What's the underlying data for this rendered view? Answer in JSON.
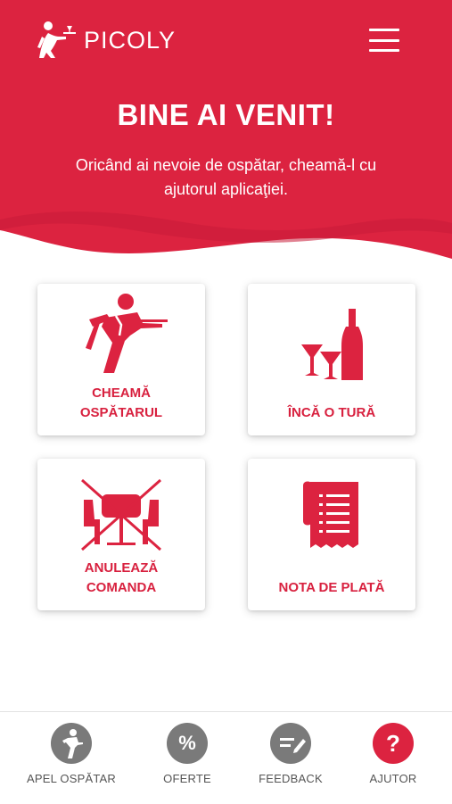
{
  "app": {
    "name": "PICOLY"
  },
  "colors": {
    "brand": "#dc2340",
    "icon_grey": "#7a7a7a",
    "text_grey": "#555555"
  },
  "header": {
    "title": "BINE AI VENIT!",
    "subtitle": "Oricând ai nevoie de ospătar, cheamă-l cu ajutorul aplicaţiei."
  },
  "actions": [
    {
      "label": "CHEAMĂ\nOSPĂTARUL",
      "icon": "waiter-icon"
    },
    {
      "label": "ÎNCĂ O TURĂ",
      "icon": "drinks-icon"
    },
    {
      "label": "ANULEAZĂ\nCOMANDA",
      "icon": "cancel-table-icon"
    },
    {
      "label": "NOTA DE PLATĂ",
      "icon": "receipt-icon"
    }
  ],
  "bottom_nav": [
    {
      "label": "APEL OSPĂTAR",
      "icon": "waiter-call-icon"
    },
    {
      "label": "OFERTE",
      "icon": "percent-icon"
    },
    {
      "label": "FEEDBACK",
      "icon": "feedback-icon"
    },
    {
      "label": "AJUTOR",
      "icon": "help-icon",
      "active": true
    }
  ]
}
